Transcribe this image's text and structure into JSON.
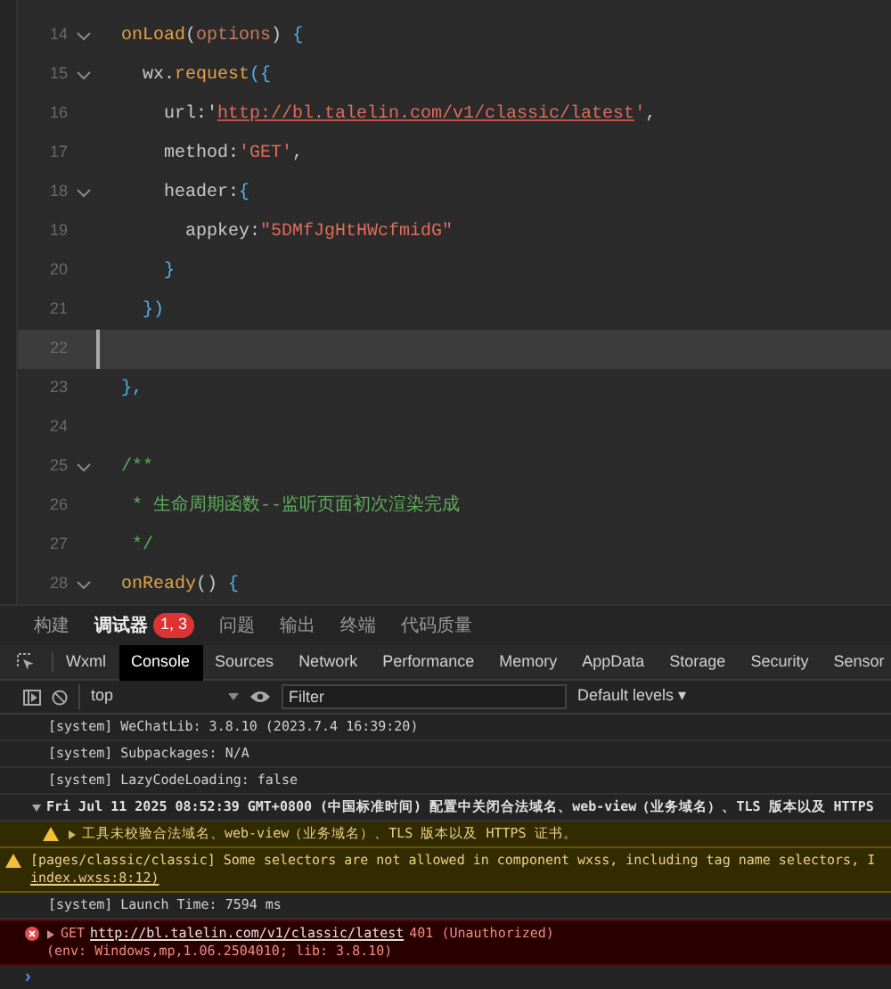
{
  "editor": {
    "lines": [
      {
        "number": "14",
        "fold": true,
        "active": false,
        "tokens": [
          {
            "text": "onLoad",
            "kind": "func"
          },
          {
            "text": "(",
            "kind": "punct"
          },
          {
            "text": "options",
            "kind": "param"
          },
          {
            "text": ") ",
            "kind": "punct"
          },
          {
            "text": "{",
            "kind": "brace"
          }
        ]
      },
      {
        "number": "15",
        "fold": true,
        "active": false,
        "tokens": [
          {
            "text": "  wx.",
            "kind": "plain"
          },
          {
            "text": "request",
            "kind": "func"
          },
          {
            "text": "({",
            "kind": "brace"
          }
        ]
      },
      {
        "number": "16",
        "fold": false,
        "active": false,
        "tokens": [
          {
            "text": "    url:'",
            "kind": "plain"
          },
          {
            "text": "http://bl.talelin.com/v1/classic/latest",
            "kind": "link"
          },
          {
            "text": "'",
            "kind": "string"
          },
          {
            "text": ",",
            "kind": "plain"
          }
        ]
      },
      {
        "number": "17",
        "fold": false,
        "active": false,
        "tokens": [
          {
            "text": "    method:",
            "kind": "plain"
          },
          {
            "text": "'GET'",
            "kind": "string"
          },
          {
            "text": ",",
            "kind": "plain"
          }
        ]
      },
      {
        "number": "18",
        "fold": true,
        "active": false,
        "tokens": [
          {
            "text": "    header:",
            "kind": "plain"
          },
          {
            "text": "{",
            "kind": "brace"
          }
        ]
      },
      {
        "number": "19",
        "fold": false,
        "active": false,
        "tokens": [
          {
            "text": "      appkey:",
            "kind": "plain"
          },
          {
            "text": "\"5DMfJgHtHWcfmidG\"",
            "kind": "string"
          }
        ]
      },
      {
        "number": "20",
        "fold": false,
        "active": false,
        "tokens": [
          {
            "text": "    }",
            "kind": "brace"
          }
        ]
      },
      {
        "number": "21",
        "fold": false,
        "active": false,
        "tokens": [
          {
            "text": "  })",
            "kind": "brace"
          }
        ]
      },
      {
        "number": "22",
        "fold": false,
        "active": true
      },
      {
        "number": "23",
        "fold": false,
        "active": false,
        "tokens": [
          {
            "text": "},",
            "kind": "brace"
          }
        ]
      },
      {
        "number": "24",
        "fold": false,
        "active": false
      },
      {
        "number": "25",
        "fold": true,
        "active": false,
        "tokens": [
          {
            "text": "/**",
            "kind": "comment"
          }
        ]
      },
      {
        "number": "26",
        "fold": false,
        "active": false,
        "tokens": [
          {
            "text": " * 生命周期函数--监听页面初次渲染完成",
            "kind": "comment"
          }
        ]
      },
      {
        "number": "27",
        "fold": false,
        "active": false,
        "tokens": [
          {
            "text": " */",
            "kind": "comment"
          }
        ]
      },
      {
        "number": "28",
        "fold": true,
        "active": false,
        "tokens": [
          {
            "text": "onReady",
            "kind": "func"
          },
          {
            "text": "() ",
            "kind": "punct"
          },
          {
            "text": "{",
            "kind": "brace"
          }
        ]
      }
    ]
  },
  "panel_tabs": [
    {
      "label": "构建",
      "selected": false
    },
    {
      "label": "调试器",
      "selected": true,
      "badge": "1, 3"
    },
    {
      "label": "问题",
      "selected": false
    },
    {
      "label": "输出",
      "selected": false
    },
    {
      "label": "终端",
      "selected": false
    },
    {
      "label": "代码质量",
      "selected": false
    }
  ],
  "devtools_tabs": [
    {
      "label": "Wxml",
      "selected": false
    },
    {
      "label": "Console",
      "selected": true
    },
    {
      "label": "Sources",
      "selected": false
    },
    {
      "label": "Network",
      "selected": false
    },
    {
      "label": "Performance",
      "selected": false
    },
    {
      "label": "Memory",
      "selected": false
    },
    {
      "label": "AppData",
      "selected": false
    },
    {
      "label": "Storage",
      "selected": false
    },
    {
      "label": "Security",
      "selected": false
    },
    {
      "label": "Sensor",
      "selected": false
    }
  ],
  "toolbar": {
    "context": "top",
    "filter_placeholder": "Filter",
    "levels": "Default levels ▾"
  },
  "console": [
    {
      "kind": "info",
      "text": "[system] WeChatLib: 3.8.10 (2023.7.4 16:39:20)"
    },
    {
      "kind": "info",
      "text": "[system] Subpackages: N/A"
    },
    {
      "kind": "info",
      "text": "[system] LazyCodeLoading: false"
    },
    {
      "kind": "group",
      "expanded": true,
      "text": "Fri Jul 11 2025 08:52:39 GMT+0800 (中国标准时间) 配置中关闭合法域名、web-view（业务域名）、TLS 版本以及 HTTPS"
    },
    {
      "kind": "warning",
      "indented": true,
      "expanded": false,
      "text": "工具未校验合法域名、web-view（业务域名）、TLS 版本以及 HTTPS 证书。"
    },
    {
      "kind": "warning",
      "indented": false,
      "text": "[pages/classic/classic] Some selectors are not allowed in component wxss, including tag name selectors, I",
      "link": "index.wxss:8:12)"
    },
    {
      "kind": "info",
      "text": "[system] Launch Time: 7594 ms"
    },
    {
      "kind": "error",
      "expanded": false,
      "method": "GET",
      "url": "http://bl.talelin.com/v1/classic/latest",
      "text": "401 (Unauthorized)",
      "detail": "(env: Windows,mp,1.06.2504010; lib: 3.8.10)"
    }
  ],
  "prompt": "›"
}
